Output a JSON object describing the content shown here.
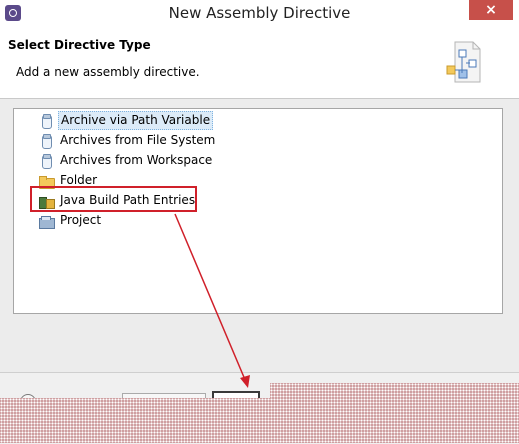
{
  "window": {
    "title": "New Assembly Directive",
    "close_label": "×"
  },
  "header": {
    "title": "Select Directive Type",
    "description": "Add a new assembly directive.",
    "icon": "wizard-banner-icon"
  },
  "tree": {
    "items": [
      {
        "label": "Archive via Path Variable",
        "icon": "jar-icon",
        "selected": true
      },
      {
        "label": "Archives from File System",
        "icon": "jar-icon",
        "selected": false
      },
      {
        "label": "Archives from Workspace",
        "icon": "jar-icon",
        "selected": false
      },
      {
        "label": "Folder",
        "icon": "folder-icon",
        "selected": false
      },
      {
        "label": "Java Build Path Entries",
        "icon": "library-icon",
        "selected": false
      },
      {
        "label": "Project",
        "icon": "project-icon",
        "selected": false
      }
    ]
  },
  "annotation": {
    "color": "#d0202a",
    "highlighted_item": "Java Build Path Entries"
  },
  "footer": {
    "help_icon": "help-icon"
  },
  "colors": {
    "close_button": "#c7504a",
    "selection": "#dcebf8",
    "redaction": "#cf9fa1"
  }
}
